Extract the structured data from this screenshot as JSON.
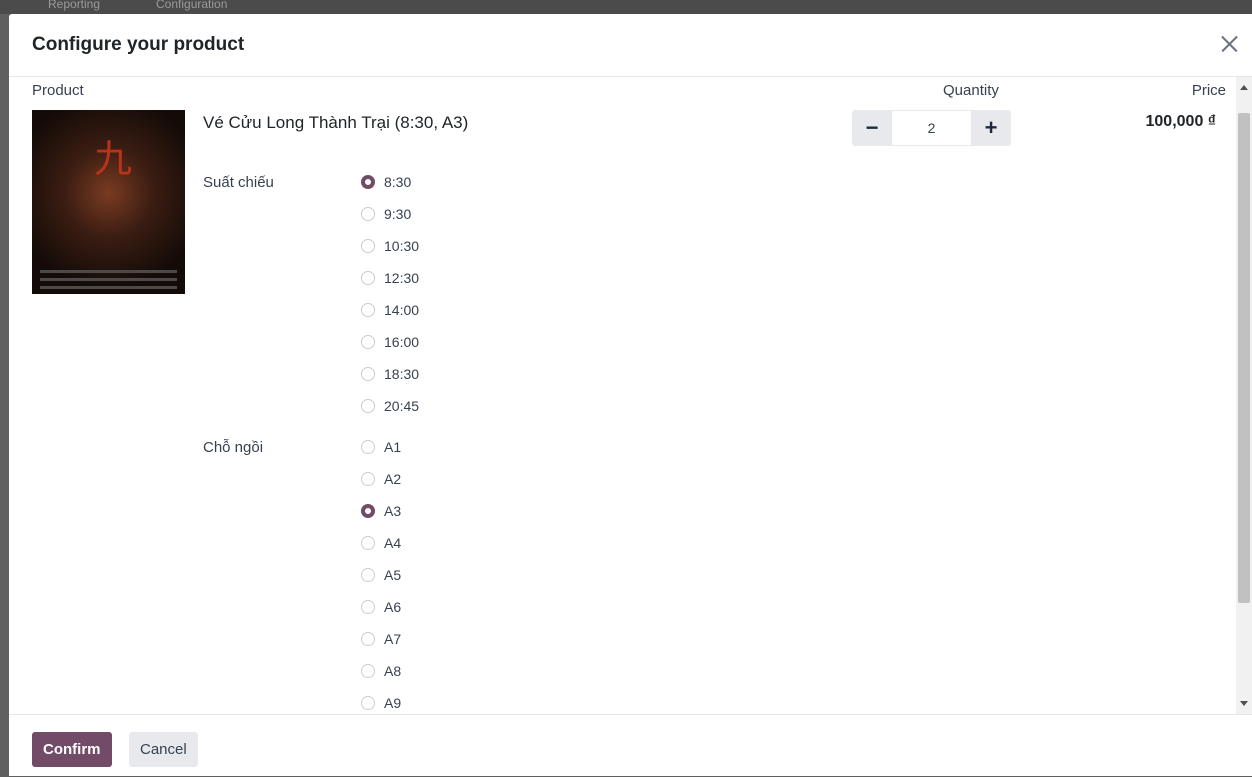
{
  "backdrop": {
    "crumb_1": "Reporting",
    "crumb_2": "Configuration"
  },
  "dialog": {
    "title": "Configure your product",
    "close_icon": "close-icon"
  },
  "table": {
    "col_product": "Product",
    "col_quantity": "Quantity",
    "col_price": "Price"
  },
  "product": {
    "name": "Vé Cửu Long Thành Trại (8:30, A3)",
    "quantity": "2",
    "price": "100,000 ₫",
    "image_icon": "movie-poster-image"
  },
  "attributes": {
    "showtime": {
      "label": "Suất chiếu",
      "selected": "8:30",
      "options": [
        "8:30",
        "9:30",
        "10:30",
        "12:30",
        "14:00",
        "16:00",
        "18:30",
        "20:45"
      ]
    },
    "seat": {
      "label": "Chỗ ngồi",
      "selected": "A3",
      "options": [
        "A1",
        "A2",
        "A3",
        "A4",
        "A5",
        "A6",
        "A7",
        "A8",
        "A9"
      ]
    }
  },
  "footer": {
    "confirm_label": "Confirm",
    "cancel_label": "Cancel"
  },
  "colors": {
    "primary": "#714b67",
    "secondary_bg": "#e7e9ed"
  }
}
